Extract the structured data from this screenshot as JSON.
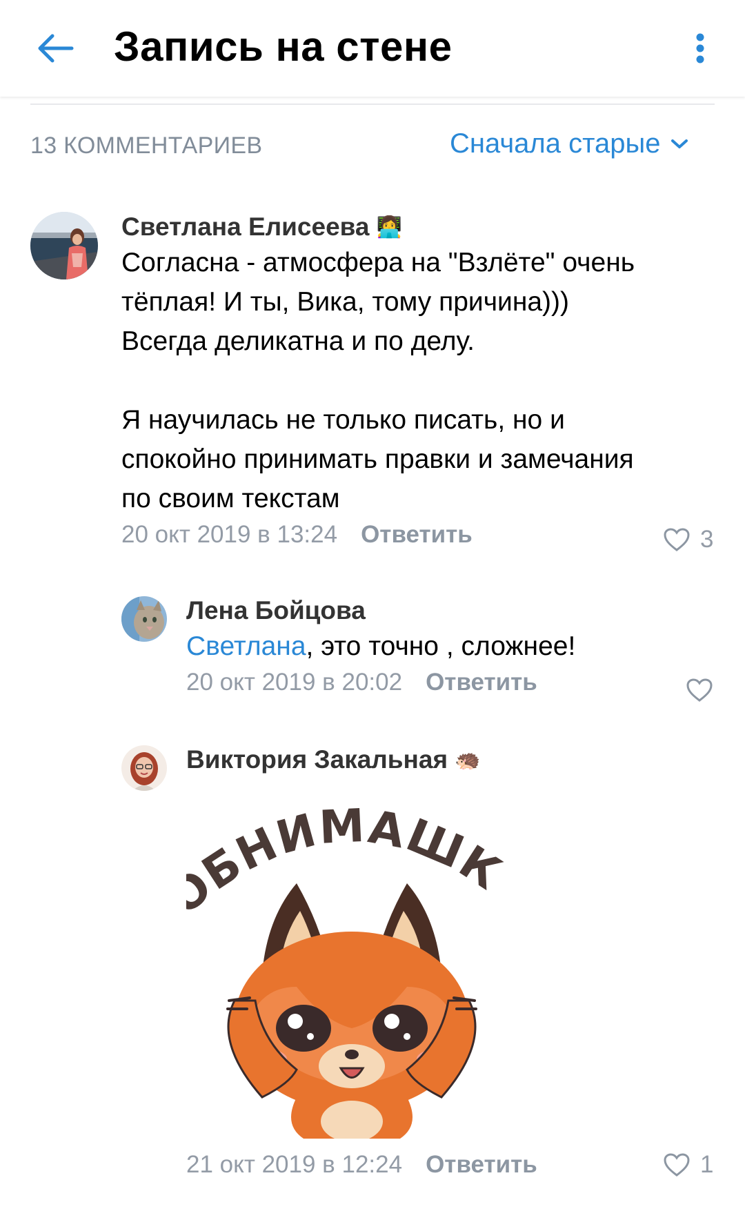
{
  "header": {
    "title": "Запись на стене",
    "back_icon": "arrow-left-icon",
    "more_icon": "more-vertical-icon",
    "accent": "#2a88d6"
  },
  "comments_bar": {
    "count_label": "13 КОММЕНТАРИЕВ",
    "sort_label": "Сначала старые"
  },
  "comments": [
    {
      "author": "Светлана Елисеева",
      "emoji": "👩‍💻",
      "lines": [
        "Согласна - атмосфера на \"Взлёте\" очень",
        "тёплая! И ты, Вика, тому причина)))",
        "Всегда деликатна и по делу.",
        "",
        "Я научилась не только писать, но и",
        "спокойно принимать правки и замечания",
        "по своим текстам"
      ],
      "date": "20 окт 2019 в 13:24",
      "reply_label": "Ответить",
      "likes": "3"
    },
    {
      "author": "Лена Бойцова",
      "mention": "Светлана",
      "text": ", это точно , сложнее!",
      "date": "20 окт 2019 в 20:02",
      "reply_label": "Ответить",
      "likes": ""
    },
    {
      "author": "Виктория Закальная",
      "emoji": "🦔",
      "sticker_text": "ОБНИМАШКИ",
      "date": "21 окт 2019 в 12:24",
      "reply_label": "Ответить",
      "likes": "1"
    }
  ]
}
